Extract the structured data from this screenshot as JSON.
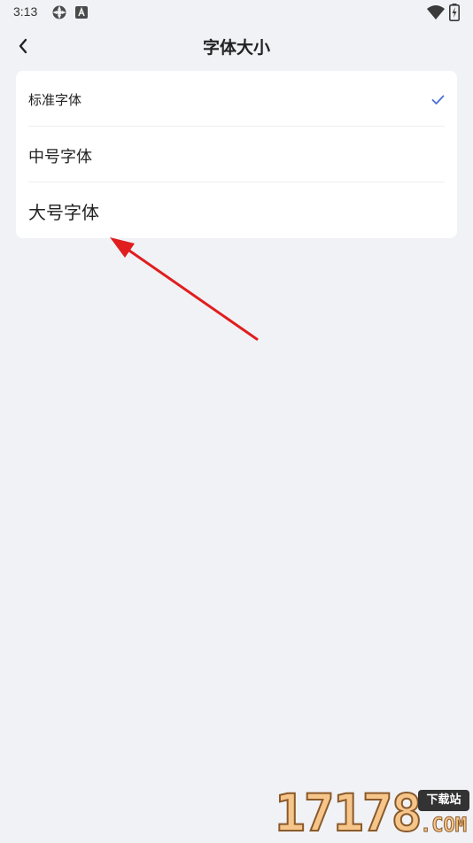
{
  "status_bar": {
    "time": "3:13",
    "icons": [
      "sync-icon",
      "a-badge-icon",
      "wifi-icon",
      "battery-charging-icon"
    ]
  },
  "app_bar": {
    "back_icon": "chevron-left-icon",
    "title": "字体大小"
  },
  "font_options": [
    {
      "label": "标准字体",
      "selected": true
    },
    {
      "label": "中号字体",
      "selected": false
    },
    {
      "label": "大号字体",
      "selected": false
    }
  ],
  "watermark": {
    "digits": "17178",
    "badge": "下载站",
    "suffix": ".COM"
  },
  "colors": {
    "background": "#f0f2f6",
    "card": "#ffffff",
    "check": "#4a6fd6",
    "arrow": "#e01e1e"
  }
}
